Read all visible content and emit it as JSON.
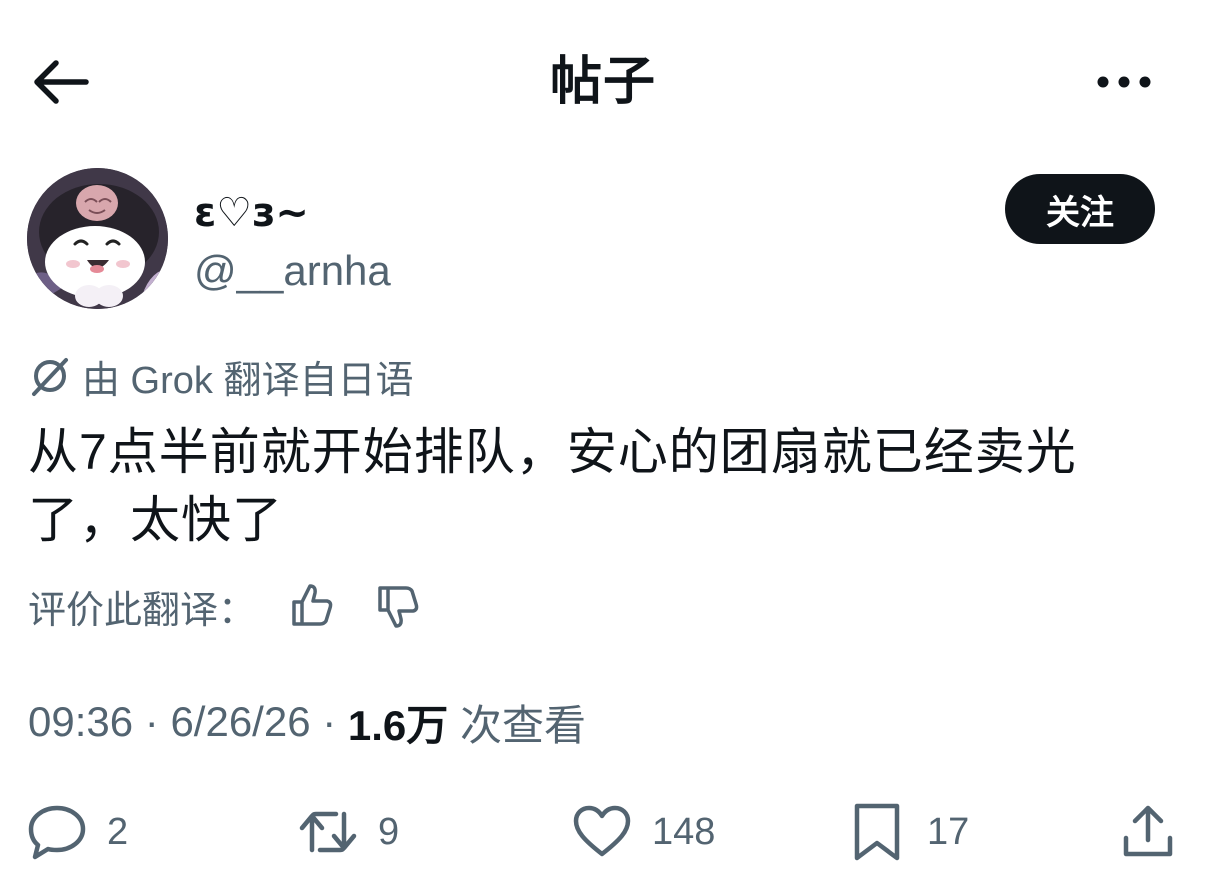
{
  "header": {
    "title": "帖子",
    "back_icon": "arrow-left-icon",
    "more_icon": "more-horizontal-icon"
  },
  "author": {
    "display_name": "ε♡з~",
    "handle": "@__arnha",
    "follow_label": "关注"
  },
  "translation": {
    "note": "由 Grok 翻译自日语",
    "text": "从7点半前就开始排队，安心的团扇就已经卖光了，太快了",
    "rate_label": "评价此翻译："
  },
  "meta": {
    "time": "09:36",
    "sep": " · ",
    "date": "6/26/26",
    "views_count": "1.6万",
    "views_label": " 次查看"
  },
  "actions": {
    "replies": "2",
    "reposts": "9",
    "likes": "148",
    "bookmarks": "17"
  },
  "colors": {
    "text": "#0f1419",
    "secondary": "#536471",
    "button": "#0f1419"
  }
}
